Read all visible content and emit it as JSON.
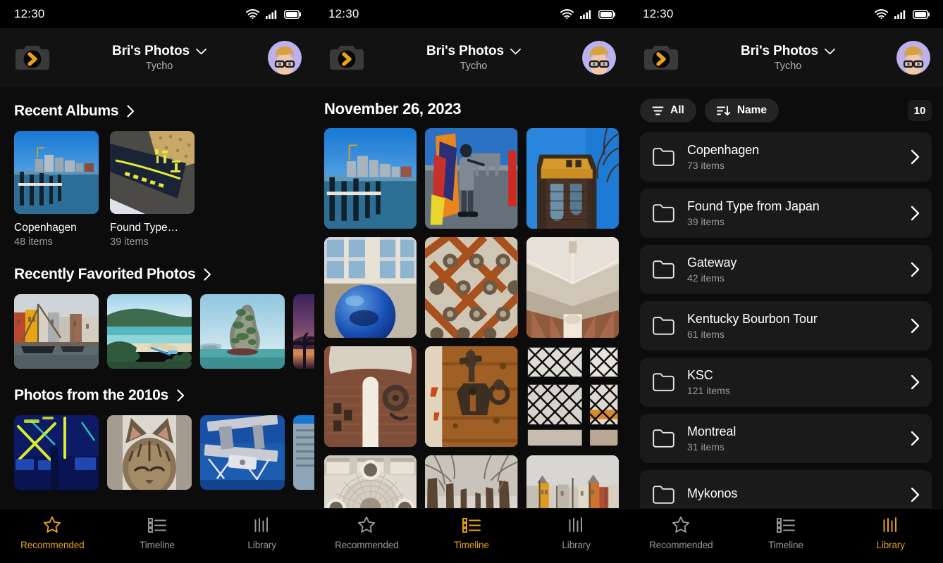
{
  "colors": {
    "accent": "#e8a317",
    "bg": "#0c0c0c",
    "header_bg": "#121212",
    "card_bg": "#1a1a1a",
    "chip_bg": "#242424",
    "muted_text": "#9a9a9a"
  },
  "status_bar": {
    "time": "12:30",
    "icons": [
      "wifi-icon",
      "cellular-signal-icon",
      "battery-icon"
    ]
  },
  "header": {
    "logo_icon": "camera-logo-icon",
    "title": "Bri's Photos",
    "title_chevron_icon": "chevron-down-icon",
    "subtitle": "Tycho",
    "avatar_icon": "user-avatar"
  },
  "panels": [
    {
      "id": "recommended",
      "sections": [
        {
          "title": "Recent Albums",
          "chevron_icon": "chevron-right-icon",
          "type": "albums",
          "albums": [
            {
              "name": "Copenhagen",
              "count": "48 items",
              "thumb": "copenhagen-harbor"
            },
            {
              "name": "Found Type…",
              "count": "39 items",
              "thumb": "japanese-signage"
            }
          ]
        },
        {
          "title": "Recently Favorited Photos",
          "chevron_icon": "chevron-right-icon",
          "type": "strip",
          "photos": [
            "nyhavn-boats",
            "tropical-beach",
            "karst-rock",
            "purple-sunset-palms"
          ]
        },
        {
          "title": "Photos from the 2010s",
          "chevron_icon": "chevron-right-icon",
          "type": "strip",
          "photos": [
            "neon-laser-club",
            "tabby-cat",
            "space-station-truss",
            "city-skyscraper"
          ]
        }
      ],
      "tabs": [
        {
          "label": "Recommended",
          "icon": "star-icon",
          "active": true
        },
        {
          "label": "Timeline",
          "icon": "list-icon",
          "active": false
        },
        {
          "label": "Library",
          "icon": "library-bars-icon",
          "active": false
        }
      ]
    },
    {
      "id": "timeline",
      "date_heading": "November 26, 2023",
      "grid_photos": [
        "copenhagen-harbor-pylons",
        "person-carrying-kite",
        "brick-tower-blue-sky",
        "blue-glass-sphere",
        "ornate-wooden-ceiling",
        "cathedral-nave",
        "vaulted-brick-chapel",
        "iron-door-latch",
        "lattice-window",
        "domed-rotunda-ceiling",
        "snowy-tree-path",
        "nyhavn-waterfront"
      ],
      "tabs": [
        {
          "label": "Recommended",
          "icon": "star-icon",
          "active": false
        },
        {
          "label": "Timeline",
          "icon": "list-icon",
          "active": true
        },
        {
          "label": "Library",
          "icon": "library-bars-icon",
          "active": false
        }
      ]
    },
    {
      "id": "library",
      "filter_chip": {
        "label": "All",
        "icon": "filter-icon"
      },
      "sort_chip": {
        "label": "Name",
        "icon": "sort-descending-icon"
      },
      "count_badge": "10",
      "albums": [
        {
          "name": "Copenhagen",
          "count": "73 items"
        },
        {
          "name": "Found Type from Japan",
          "count": "39 items"
        },
        {
          "name": "Gateway",
          "count": "42 items"
        },
        {
          "name": "Kentucky Bourbon Tour",
          "count": "61 items"
        },
        {
          "name": "KSC",
          "count": "121 items"
        },
        {
          "name": "Montreal",
          "count": "31 items"
        },
        {
          "name": "Mykonos",
          "count": ""
        }
      ],
      "row_icon": "folder-icon",
      "row_chevron_icon": "chevron-right-icon",
      "tabs": [
        {
          "label": "Recommended",
          "icon": "star-icon",
          "active": false
        },
        {
          "label": "Timeline",
          "icon": "list-icon",
          "active": false
        },
        {
          "label": "Library",
          "icon": "library-bars-icon",
          "active": true
        }
      ]
    }
  ]
}
